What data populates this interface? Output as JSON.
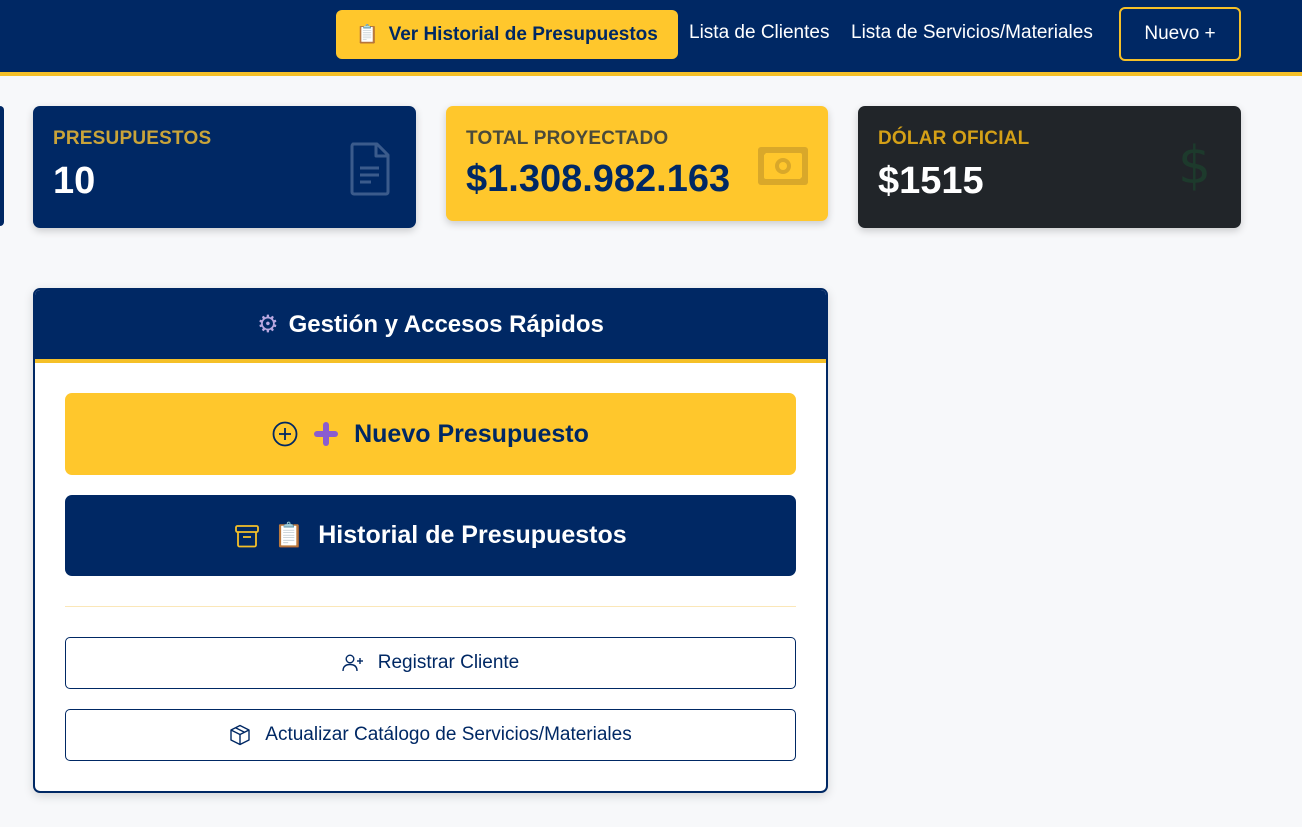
{
  "nav": {
    "history_label": "Ver Historial de Presupuestos",
    "clients_label": "Lista de Clientes",
    "services_label": "Lista de Servicios/Materiales",
    "new_label": "Nuevo +"
  },
  "stats": {
    "budgets": {
      "label": "PRESUPUESTOS",
      "value": "10",
      "icon": "document-icon"
    },
    "total": {
      "label": "TOTAL PROYECTADO",
      "value": "$1.308.982.163",
      "icon": "cash-icon"
    },
    "dollar": {
      "label": "DÓLAR OFICIAL",
      "value": "$1515",
      "icon": "dollar-icon"
    }
  },
  "panel": {
    "title": "Gestión y Accesos Rápidos",
    "new_budget_label": "Nuevo Presupuesto",
    "history_label": "Historial de Presupuestos",
    "register_client_label": "Registrar Cliente",
    "update_catalog_label": "Actualizar Catálogo de Servicios/Materiales"
  },
  "colors": {
    "navy": "#002864",
    "yellow": "#ffc72c",
    "dark": "#212529",
    "label_gold": "#d4a017"
  }
}
